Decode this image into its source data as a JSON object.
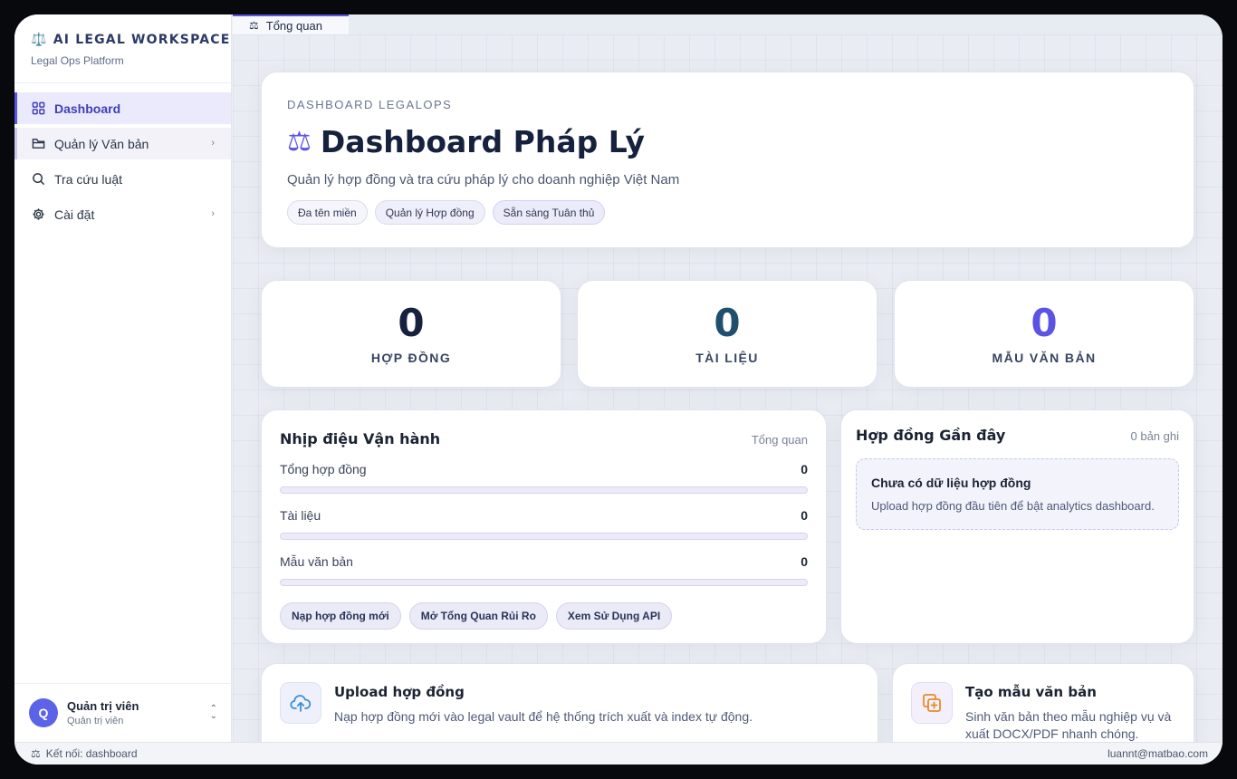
{
  "brand": {
    "title": "⚖️ AI LEGAL WORKSPACE",
    "subtitle": "Legal Ops Platform"
  },
  "sidebar": {
    "items": [
      {
        "label": "Dashboard",
        "icon": "grid-icon"
      },
      {
        "label": "Quản lý Văn bản",
        "icon": "folder-icon"
      },
      {
        "label": "Tra cứu luật",
        "icon": "search-icon"
      },
      {
        "label": "Cài đặt",
        "icon": "gear-icon"
      }
    ]
  },
  "user": {
    "initial": "Q",
    "name": "Quản trị viên",
    "role": "Quản trị viên"
  },
  "tab": {
    "label": "Tổng quan",
    "icon": "scale-icon"
  },
  "hero": {
    "kicker": "DASHBOARD LEGALOPS",
    "title": "Dashboard Pháp Lý",
    "subtitle": "Quản lý hợp đồng và tra cứu pháp lý cho doanh nghiệp Việt Nam",
    "chips": [
      "Đa tên miền",
      "Quản lý Hợp đồng",
      "Sẵn sàng Tuân thủ"
    ]
  },
  "stats": [
    {
      "value": "0",
      "label": "HỢP ĐỒNG",
      "color": "#16213d"
    },
    {
      "value": "0",
      "label": "TÀI LIỆU",
      "color": "#1f4f6e"
    },
    {
      "value": "0",
      "label": "MẪU VĂN BẢN",
      "color": "#5b53e3"
    }
  ],
  "ops": {
    "title": "Nhịp điệu Vận hành",
    "meta": "Tổng quan",
    "metrics": [
      {
        "label": "Tổng hợp đồng",
        "value": "0"
      },
      {
        "label": "Tài liệu",
        "value": "0"
      },
      {
        "label": "Mẫu văn bản",
        "value": "0"
      }
    ],
    "actions": [
      "Nạp hợp đồng mới",
      "Mở Tổng Quan Rủi Ro",
      "Xem Sử Dụng API"
    ]
  },
  "recent": {
    "title": "Hợp đồng Gần đây",
    "meta": "0 bản ghi",
    "empty_title": "Chưa có dữ liệu hợp đồng",
    "empty_sub": "Upload hợp đồng đầu tiên để bật analytics dashboard."
  },
  "quick": [
    {
      "title": "Upload hợp đồng",
      "sub": "Nạp hợp đồng mới vào legal vault để hệ thống trích xuất và index tự động.",
      "icon": "upload-cloud-icon"
    },
    {
      "title": "Tạo mẫu văn bản",
      "sub": "Sinh văn bản theo mẫu nghiệp vụ và xuất DOCX/PDF nhanh chóng.",
      "icon": "add-copy-icon"
    }
  ],
  "status": {
    "left": "Kết nối: dashboard",
    "right": "luannt@matbao.com"
  }
}
